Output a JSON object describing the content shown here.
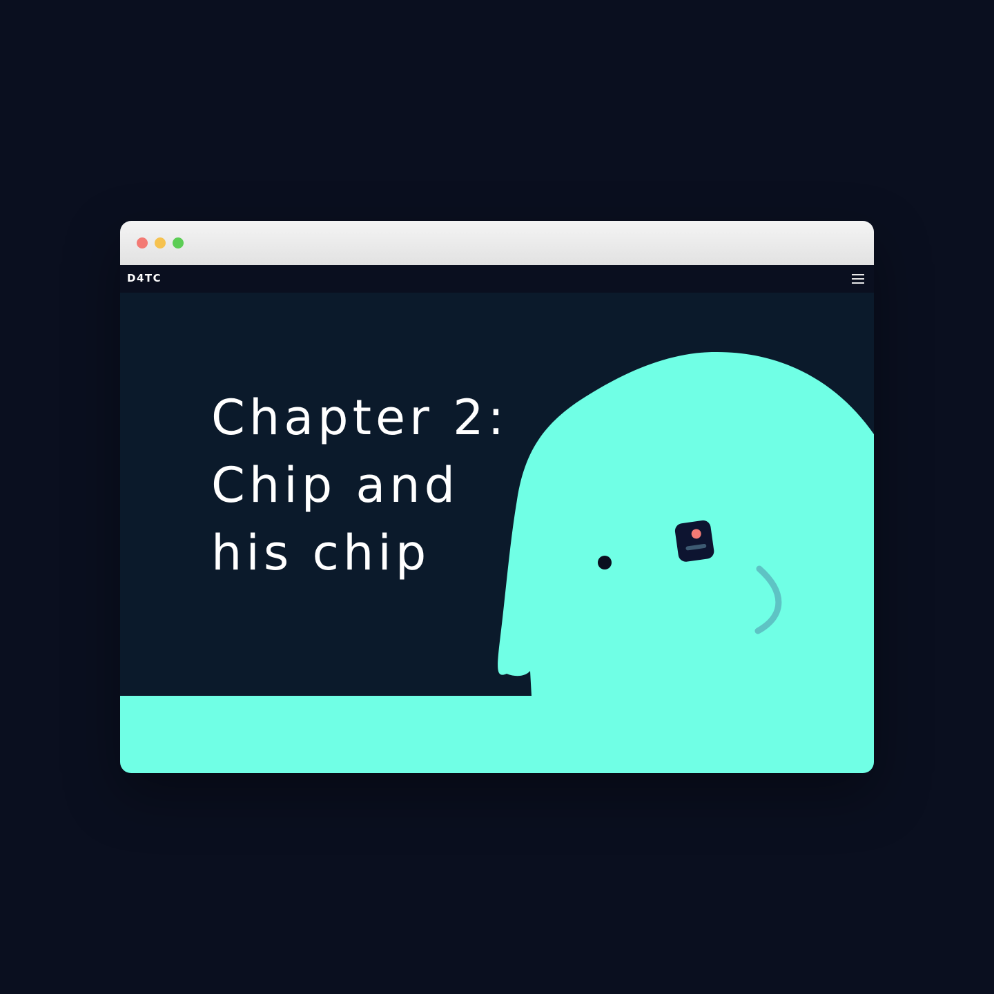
{
  "browser": {
    "controls": [
      "close",
      "minimize",
      "maximize"
    ]
  },
  "nav": {
    "logo": "D4TC",
    "menu_icon": "hamburger-menu-icon"
  },
  "hero": {
    "title_lines": [
      "Chapter 2:",
      "Chip and",
      "his chip"
    ]
  },
  "colors": {
    "background": "#0a0f1f",
    "hero_background": "#0b1a2b",
    "character": "#70ffe5",
    "chip": "#0d1430",
    "chip_dot": "#f37a74",
    "chip_line": "#3d5a72",
    "smile": "#5ec3c4",
    "eye": "#0a0f1f"
  }
}
